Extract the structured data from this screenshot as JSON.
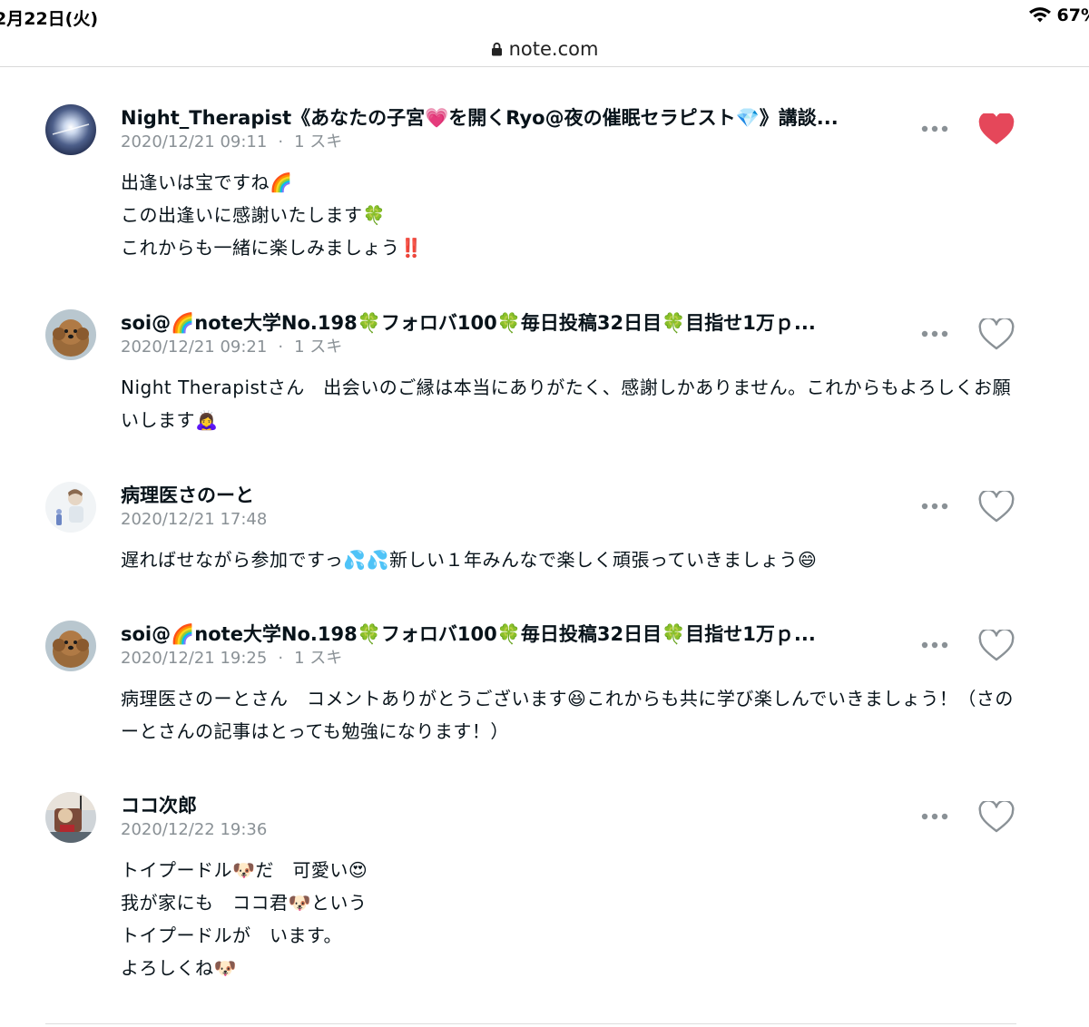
{
  "status_bar": {
    "time": "2月22日(火)",
    "battery": "67%"
  },
  "browser": {
    "url": "note.com"
  },
  "comments": [
    {
      "author": "Night_Therapist《あなたの子宮💗を開くRyo@夜の催眠セラピスト💎》講談...",
      "date": "2020/12/21 09:11",
      "likes": "1 スキ",
      "liked": true,
      "body": [
        "出逢いは宝ですね🌈",
        "この出逢いに感謝いたします🍀",
        "これからも一緒に楽しみましょう‼️"
      ]
    },
    {
      "author": "soi@🌈note大学No.198🍀フォロバ100🍀毎日投稿32日目🍀目指せ1万ｐ...",
      "date": "2020/12/21 09:21",
      "likes": "1 スキ",
      "liked": false,
      "body": [
        "Night Therapistさん　出会いのご縁は本当にありがたく、感謝しかありません。これからもよろしくお願いします🙇‍♀️"
      ]
    },
    {
      "author": "病理医さのーと",
      "date": "2020/12/21 17:48",
      "likes": "",
      "liked": false,
      "body": [
        "遅ればせながら参加ですっ💦💦新しい１年みんなで楽しく頑張っていきましょう😄"
      ]
    },
    {
      "author": "soi@🌈note大学No.198🍀フォロバ100🍀毎日投稿32日目🍀目指せ1万ｐ...",
      "date": "2020/12/21 19:25",
      "likes": "1 スキ",
      "liked": false,
      "body": [
        "病理医さのーとさん　コメントありがとうございます😆これからも共に学び楽しんでいきましょう！（さのーとさんの記事はとっても勉強になります！）"
      ]
    },
    {
      "author": "ココ次郎",
      "date": "2020/12/22 19:36",
      "likes": "",
      "liked": false,
      "body": [
        "トイプードル🐶だ　可愛い😍",
        "我が家にも　ココ君🐶という",
        "トイプードルが　います。",
        "よろしくね🐶"
      ]
    }
  ],
  "colors": {
    "like_active": "#e5475a",
    "icon_gray": "#8a9196"
  }
}
